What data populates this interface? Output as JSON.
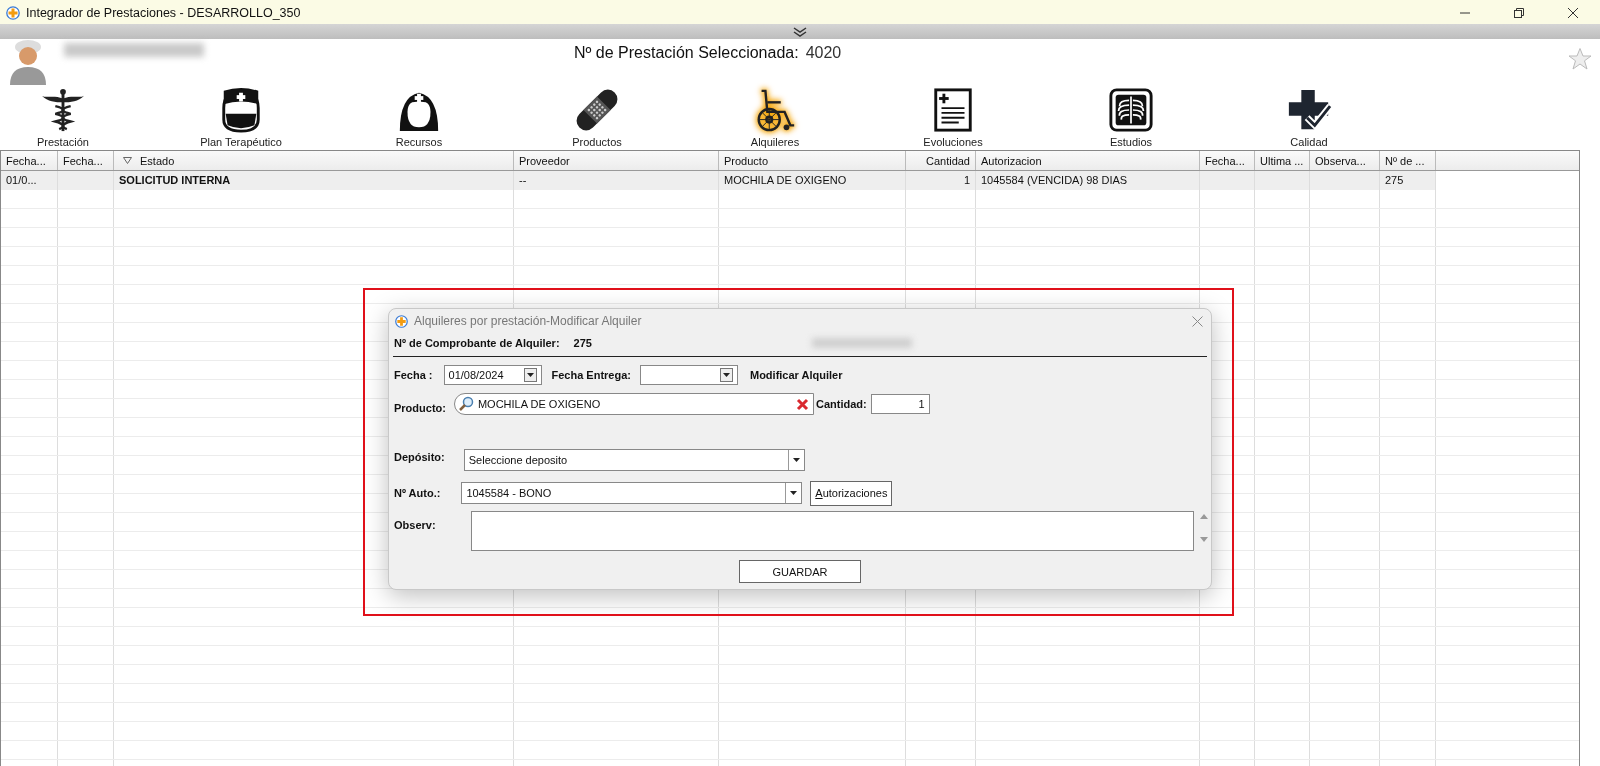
{
  "window": {
    "title": "Integrador de Prestaciones - DESARROLLO_350"
  },
  "header": {
    "label": "Nº de Prestación Seleccionada:",
    "value": "4020"
  },
  "toolbar": [
    {
      "label": "Prestación",
      "selected": false
    },
    {
      "label": "Plan Terapéutico",
      "selected": false
    },
    {
      "label": "Recursos",
      "selected": false
    },
    {
      "label": "Productos",
      "selected": false
    },
    {
      "label": "Alquileres",
      "selected": true
    },
    {
      "label": "Evoluciones",
      "selected": false
    },
    {
      "label": "Estudios",
      "selected": false
    },
    {
      "label": "Calidad",
      "selected": false
    }
  ],
  "table": {
    "columns": [
      {
        "label": "Fecha...",
        "sorted": false
      },
      {
        "label": "Fecha...",
        "sorted": false
      },
      {
        "label": "Estado",
        "sorted": true
      },
      {
        "label": "Proveedor",
        "sorted": false
      },
      {
        "label": "Producto",
        "sorted": false
      },
      {
        "label": "Cantidad",
        "sorted": false
      },
      {
        "label": "Autorizacion",
        "sorted": false
      },
      {
        "label": "Fecha...",
        "sorted": false
      },
      {
        "label": "Ultima ...",
        "sorted": false
      },
      {
        "label": "Observa...",
        "sorted": false
      },
      {
        "label": "Nº de ...",
        "sorted": false
      }
    ],
    "rows": [
      [
        "01/0...",
        "",
        "SOLICITUD INTERNA",
        "--",
        "MOCHILA DE OXIGENO",
        "1",
        "1045584 (VENCIDA) 98 DIAS",
        "",
        "",
        "",
        "275"
      ]
    ]
  },
  "dialog": {
    "title": "Alquileres por prestación-Modificar Alquiler",
    "comprobante_label": "Nº de Comprobante de Alquiler:",
    "comprobante": "275",
    "fecha_label": "Fecha :",
    "fecha": "01/08/2024",
    "fecha_entrega_label": "Fecha Entrega:",
    "mode_label": "Modificar Alquiler",
    "producto_label": "Producto:",
    "producto": "MOCHILA DE OXIGENO",
    "cantidad_label": "Cantidad:",
    "cantidad": "1",
    "deposito_label": "Depósito:",
    "deposito": "Seleccione deposito",
    "auto_label": "Nº Auto.:",
    "auto": "1045584 - BONO",
    "autorizaciones_button": "Autorizaciones",
    "observ_label": "Observ:",
    "save_button": "GUARDAR"
  }
}
